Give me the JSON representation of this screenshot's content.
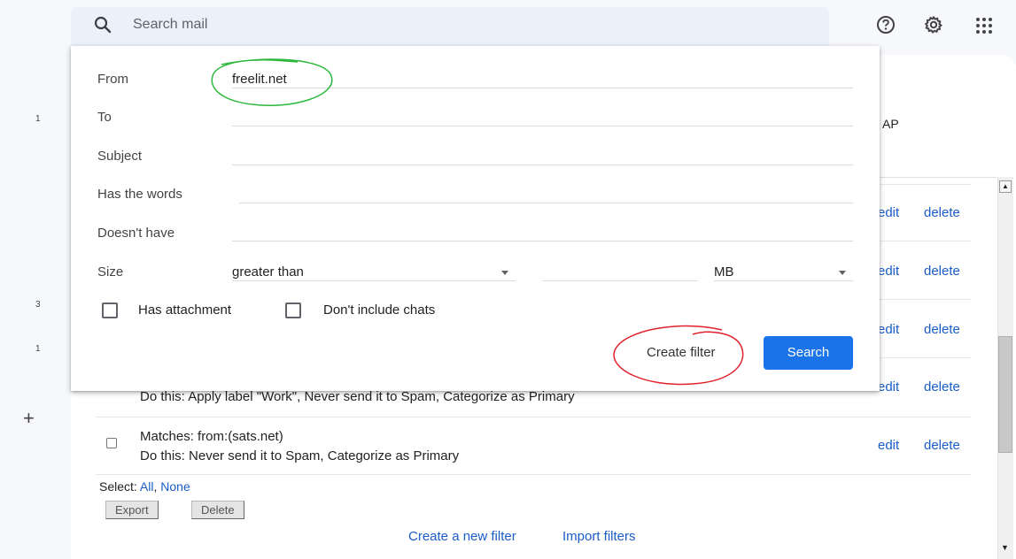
{
  "top_bar": {
    "search_placeholder": "Search mail",
    "help_icon": "help-circle-icon",
    "settings_icon": "gear-icon",
    "apps_icon": "apps-grid-icon"
  },
  "left_rail": {
    "counts": [
      "1",
      "3",
      "1"
    ],
    "add_label": "+"
  },
  "background": {
    "imap_fragment": "AP"
  },
  "filters": {
    "rows": [
      {
        "matches": "",
        "action": "",
        "edit": "edit",
        "delete": "delete"
      },
      {
        "matches": "",
        "action": "",
        "edit": "edit",
        "delete": "delete"
      },
      {
        "matches": "",
        "action": "",
        "edit": "edit",
        "delete": "delete"
      },
      {
        "matches": "",
        "action": "Do this: Apply label \"Work\", Never send it to Spam, Categorize as Primary",
        "edit": "edit",
        "delete": "delete"
      },
      {
        "matches": "Matches: from:(sats.net)",
        "action": "Do this: Never send it to Spam, Categorize as Primary",
        "edit": "edit",
        "delete": "delete"
      }
    ],
    "select_prefix": "Select: ",
    "select_all": "All",
    "select_sep": ", ",
    "select_none": "None",
    "export_label": "Export",
    "delete_label": "Delete",
    "create_new_filter": "Create a new filter",
    "import_filters": "Import filters"
  },
  "popup": {
    "from_label": "From",
    "from_value": "freelit.net",
    "to_label": "To",
    "subject_label": "Subject",
    "has_words_label": "Has the words",
    "doesnt_have_label": "Doesn't have",
    "size_label": "Size",
    "size_operator": "greater than",
    "size_unit": "MB",
    "has_attachment_label": "Has attachment",
    "dont_include_chats_label": "Don't include chats",
    "create_filter_label": "Create filter",
    "search_button_label": "Search"
  },
  "colors": {
    "accent": "#1a73e8",
    "link": "#1a5cc8",
    "annotation_green": "#2db83d",
    "annotation_red": "#e0202a"
  }
}
